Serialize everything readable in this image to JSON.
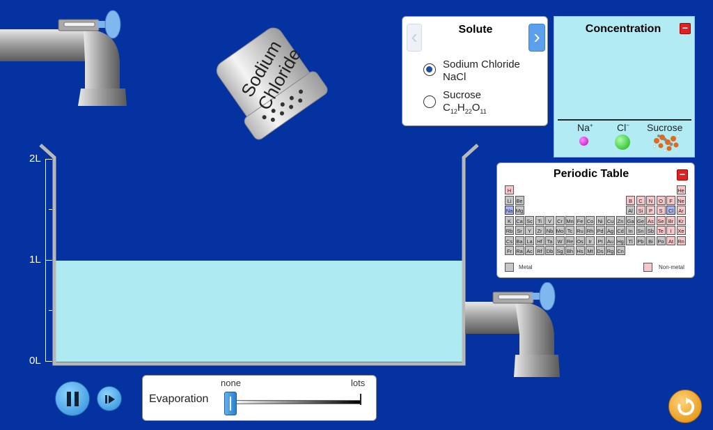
{
  "solute_panel": {
    "title": "Solute",
    "options": [
      {
        "name": "Sodium Chloride",
        "formula": "NaCl",
        "selected": true
      },
      {
        "name": "Sucrose",
        "formula_parts": [
          "C",
          "12",
          "H",
          "22",
          "O",
          "11"
        ],
        "selected": false
      }
    ]
  },
  "shaker": {
    "label_line1": "Sodium",
    "label_line2": "Chloride"
  },
  "concentration_panel": {
    "title": "Concentration",
    "collapse_label": "−",
    "labels": [
      {
        "base": "Na",
        "sup": "+",
        "color": "#d600d6"
      },
      {
        "base": "Cl",
        "sup": "−",
        "color": "#22c822"
      },
      {
        "base": "Sucrose",
        "sup": "",
        "color": "#e06a1a"
      }
    ]
  },
  "periodic_table": {
    "title": "Periodic Table",
    "collapse_label": "−",
    "legend": {
      "metal": "Metal",
      "nonmetal": "Non-metal"
    },
    "selected": [
      "Na",
      "Cl"
    ],
    "rows": [
      [
        "H",
        "",
        "",
        "",
        "",
        "",
        "",
        "",
        "",
        "",
        "",
        "",
        "",
        "",
        "",
        "",
        "",
        "He"
      ],
      [
        "Li",
        "Be",
        "",
        "",
        "",
        "",
        "",
        "",
        "",
        "",
        "",
        "",
        "B",
        "C",
        "N",
        "O",
        "F",
        "Ne"
      ],
      [
        "Na",
        "Mg",
        "",
        "",
        "",
        "",
        "",
        "",
        "",
        "",
        "",
        "",
        "Al",
        "Si",
        "P",
        "S",
        "Cl",
        "Ar"
      ],
      [
        "K",
        "Ca",
        "Sc",
        "Ti",
        "V",
        "Cr",
        "Mn",
        "Fe",
        "Co",
        "Ni",
        "Cu",
        "Zn",
        "Ga",
        "Ge",
        "As",
        "Se",
        "Br",
        "Kr"
      ],
      [
        "Rb",
        "Sr",
        "Y",
        "Zr",
        "Nb",
        "Mo",
        "Tc",
        "Ru",
        "Rh",
        "Pd",
        "Ag",
        "Cd",
        "In",
        "Sn",
        "Sb",
        "Te",
        "I",
        "Xe"
      ],
      [
        "Cs",
        "Ba",
        "La",
        "Hf",
        "Ta",
        "W",
        "Re",
        "Os",
        "Ir",
        "Pt",
        "Au",
        "Hg",
        "Tl",
        "Pb",
        "Bi",
        "Po",
        "At",
        "Rn"
      ],
      [
        "Fr",
        "Ra",
        "Ac",
        "Rf",
        "Db",
        "Sg",
        "Bh",
        "Hs",
        "Mt",
        "Ds",
        "Rg",
        "Cn",
        "",
        "",
        "",
        "",
        "",
        ""
      ]
    ],
    "nonmetals": [
      "H",
      "He",
      "B",
      "C",
      "N",
      "O",
      "F",
      "Ne",
      "Si",
      "P",
      "S",
      "Cl",
      "Ar",
      "As",
      "Se",
      "Br",
      "Kr",
      "Te",
      "I",
      "Xe",
      "At",
      "Rn"
    ]
  },
  "beaker": {
    "labels": [
      "2L",
      "1L",
      "0L"
    ],
    "fill_level_liters": 1.0,
    "max_liters": 2.0
  },
  "evaporation": {
    "label": "Evaporation",
    "min_label": "none",
    "max_label": "lots",
    "value": 0
  },
  "controls": {
    "pause": "pause-button",
    "step": "step-button",
    "reset": "reset-button"
  },
  "colors": {
    "background": "#0432a0",
    "solution": "#aeeaf2",
    "panel_cyan": "#b3ebf5"
  }
}
